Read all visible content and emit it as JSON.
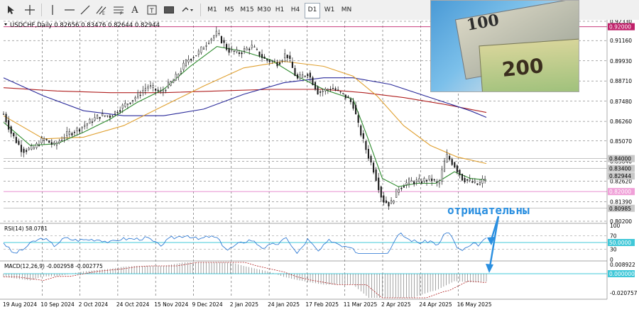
{
  "toolbar": {
    "timeframes": [
      "M1",
      "M5",
      "M15",
      "M30",
      "H1",
      "H4",
      "D1",
      "W1",
      "MN"
    ],
    "active_timeframe": "D1"
  },
  "chart_header": {
    "title": "USDCHF,Daily",
    "ohlc": "0.82656 0.83476 0.82644 0.82944"
  },
  "price_axis": {
    "ticks": [
      "0.92330",
      "0.91160",
      "0.89930",
      "0.88710",
      "0.87480",
      "0.86260",
      "0.85070",
      "0.83840",
      "0.82620",
      "0.81390",
      "0.80200"
    ],
    "labels": [
      {
        "text": "0.92000",
        "value": 0.92,
        "bg": "#c0206a",
        "fg": "#ffffff"
      },
      {
        "text": "0.84000",
        "value": 0.84,
        "bg": "#c8c8c8",
        "fg": "#000000"
      },
      {
        "text": "0.83400",
        "value": 0.834,
        "bg": "#c8c8c8",
        "fg": "#000000"
      },
      {
        "text": "0.82944",
        "value": 0.82944,
        "bg": "#c8c8c8",
        "fg": "#000000"
      },
      {
        "text": "0.82000",
        "value": 0.82,
        "bg": "#f0a0d8",
        "fg": "#ffffff"
      },
      {
        "text": "0.80985",
        "value": 0.80985,
        "bg": "#c8c8c8",
        "fg": "#000000"
      }
    ]
  },
  "rsi": {
    "label": "RSI(14) 58.0781",
    "ticks": [
      "100",
      "70",
      "30",
      "0"
    ],
    "level_label": "50.0000"
  },
  "macd": {
    "label": "MACD(12,26,9) -0.002958 -0.002775",
    "ticks": [
      "0.008922",
      "-0.020757"
    ],
    "zero_label": "0.000000"
  },
  "time_axis": {
    "labels": [
      "19 Aug 2024",
      "10 Sep 2024",
      "2 Oct 2024",
      "24 Oct 2024",
      "15 Nov 2024",
      "9 Dec 2024",
      "2 Jan 2025",
      "24 Jan 2025",
      "17 Feb 2025",
      "11 Mar 2025",
      "2 Apr 2025",
      "24 Apr 2025",
      "16 May 2025"
    ]
  },
  "annotation": {
    "text": "отрицательны",
    "color": "#2a8fe0"
  },
  "photo": {
    "dollar_text": "100",
    "franc_text": "200"
  },
  "colors": {
    "bull": "#1a1a1a",
    "sma_fast": "#2e8b2e",
    "sma_mid": "#e0a030",
    "sma_blue": "#2a2a9a",
    "sma_red": "#b02020",
    "rsi_line": "#1e6fd0",
    "rsi_level": "#40c8d8",
    "macd_signal": "#b02020"
  },
  "chart_data": {
    "type": "candlestick",
    "title": "USDCHF,Daily",
    "ylim": [
      0.802,
      0.9233
    ],
    "path": [
      [
        0,
        0.867
      ],
      [
        6,
        0.855
      ],
      [
        14,
        0.845
      ],
      [
        22,
        0.846
      ],
      [
        30,
        0.852
      ],
      [
        38,
        0.848
      ],
      [
        46,
        0.854
      ],
      [
        56,
        0.858
      ],
      [
        64,
        0.862
      ],
      [
        72,
        0.866
      ],
      [
        80,
        0.866
      ],
      [
        90,
        0.872
      ],
      [
        100,
        0.878
      ],
      [
        108,
        0.884
      ],
      [
        118,
        0.88
      ],
      [
        128,
        0.888
      ],
      [
        138,
        0.9
      ],
      [
        146,
        0.904
      ],
      [
        154,
        0.912
      ],
      [
        160,
        0.916
      ],
      [
        168,
        0.906
      ],
      [
        176,
        0.904
      ],
      [
        186,
        0.908
      ],
      [
        196,
        0.9
      ],
      [
        206,
        0.898
      ],
      [
        212,
        0.904
      ],
      [
        220,
        0.888
      ],
      [
        228,
        0.892
      ],
      [
        236,
        0.88
      ],
      [
        246,
        0.883
      ],
      [
        256,
        0.878
      ],
      [
        262,
        0.873
      ],
      [
        266,
        0.86
      ],
      [
        272,
        0.845
      ],
      [
        278,
        0.832
      ],
      [
        284,
        0.815
      ],
      [
        290,
        0.812
      ],
      [
        296,
        0.822
      ],
      [
        304,
        0.826
      ],
      [
        312,
        0.826
      ],
      [
        320,
        0.828
      ],
      [
        326,
        0.824
      ],
      [
        332,
        0.842
      ],
      [
        338,
        0.836
      ],
      [
        344,
        0.828
      ],
      [
        350,
        0.826
      ],
      [
        356,
        0.824
      ],
      [
        362,
        0.829
      ]
    ],
    "sma_fast": [
      [
        0,
        0.862
      ],
      [
        20,
        0.848
      ],
      [
        40,
        0.849
      ],
      [
        60,
        0.856
      ],
      [
        80,
        0.864
      ],
      [
        100,
        0.874
      ],
      [
        120,
        0.882
      ],
      [
        140,
        0.896
      ],
      [
        160,
        0.908
      ],
      [
        180,
        0.905
      ],
      [
        200,
        0.9
      ],
      [
        220,
        0.89
      ],
      [
        240,
        0.882
      ],
      [
        262,
        0.876
      ],
      [
        272,
        0.855
      ],
      [
        284,
        0.828
      ],
      [
        296,
        0.823
      ],
      [
        310,
        0.825
      ],
      [
        324,
        0.825
      ],
      [
        338,
        0.832
      ],
      [
        350,
        0.828
      ],
      [
        362,
        0.827
      ]
    ],
    "sma_mid": [
      [
        0,
        0.866
      ],
      [
        30,
        0.852
      ],
      [
        60,
        0.853
      ],
      [
        90,
        0.86
      ],
      [
        120,
        0.872
      ],
      [
        150,
        0.884
      ],
      [
        180,
        0.895
      ],
      [
        210,
        0.899
      ],
      [
        240,
        0.896
      ],
      [
        262,
        0.89
      ],
      [
        280,
        0.878
      ],
      [
        300,
        0.86
      ],
      [
        320,
        0.848
      ],
      [
        340,
        0.841
      ],
      [
        362,
        0.837
      ]
    ],
    "sma_blue": [
      [
        0,
        0.889
      ],
      [
        30,
        0.878
      ],
      [
        60,
        0.869
      ],
      [
        90,
        0.866
      ],
      [
        120,
        0.866
      ],
      [
        150,
        0.87
      ],
      [
        180,
        0.879
      ],
      [
        210,
        0.886
      ],
      [
        240,
        0.889
      ],
      [
        262,
        0.889
      ],
      [
        290,
        0.885
      ],
      [
        320,
        0.877
      ],
      [
        350,
        0.869
      ],
      [
        362,
        0.865
      ]
    ],
    "sma_red": [
      [
        0,
        0.883
      ],
      [
        40,
        0.881
      ],
      [
        80,
        0.88
      ],
      [
        120,
        0.88
      ],
      [
        160,
        0.881
      ],
      [
        200,
        0.882
      ],
      [
        240,
        0.882
      ],
      [
        270,
        0.88
      ],
      [
        300,
        0.877
      ],
      [
        330,
        0.873
      ],
      [
        362,
        0.868
      ]
    ]
  }
}
